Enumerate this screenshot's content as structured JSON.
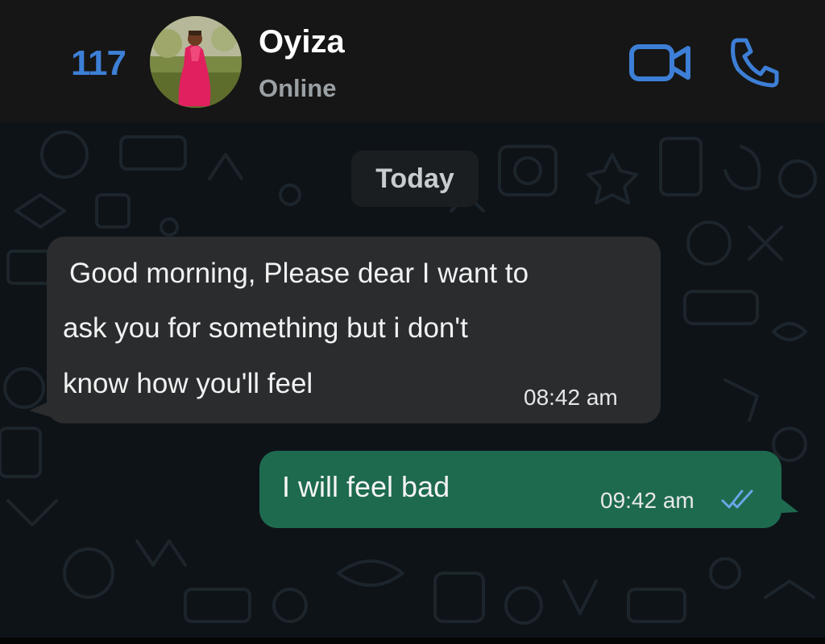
{
  "header": {
    "back_count": "117",
    "contact_name": "Oyiza",
    "contact_status": "Online",
    "avatar_icon": "profile-photo",
    "video_call_icon": "video-camera-icon",
    "voice_call_icon": "phone-icon",
    "accent_color": "#3d7fd6"
  },
  "chat": {
    "date_separator": "Today",
    "messages": [
      {
        "direction": "incoming",
        "lines": [
          "Good morning, Please dear I want to",
          "ask you for something but i don't",
          "know how you'll feel"
        ],
        "time": "08:42 am",
        "bubble_color": "#2a2c2e"
      },
      {
        "direction": "outgoing",
        "text": "I will feel bad",
        "time": "09:42 am",
        "status_icon": "double-check-icon",
        "status_color": "#6aa6e6",
        "bubble_color": "#1e6a4f"
      }
    ]
  }
}
